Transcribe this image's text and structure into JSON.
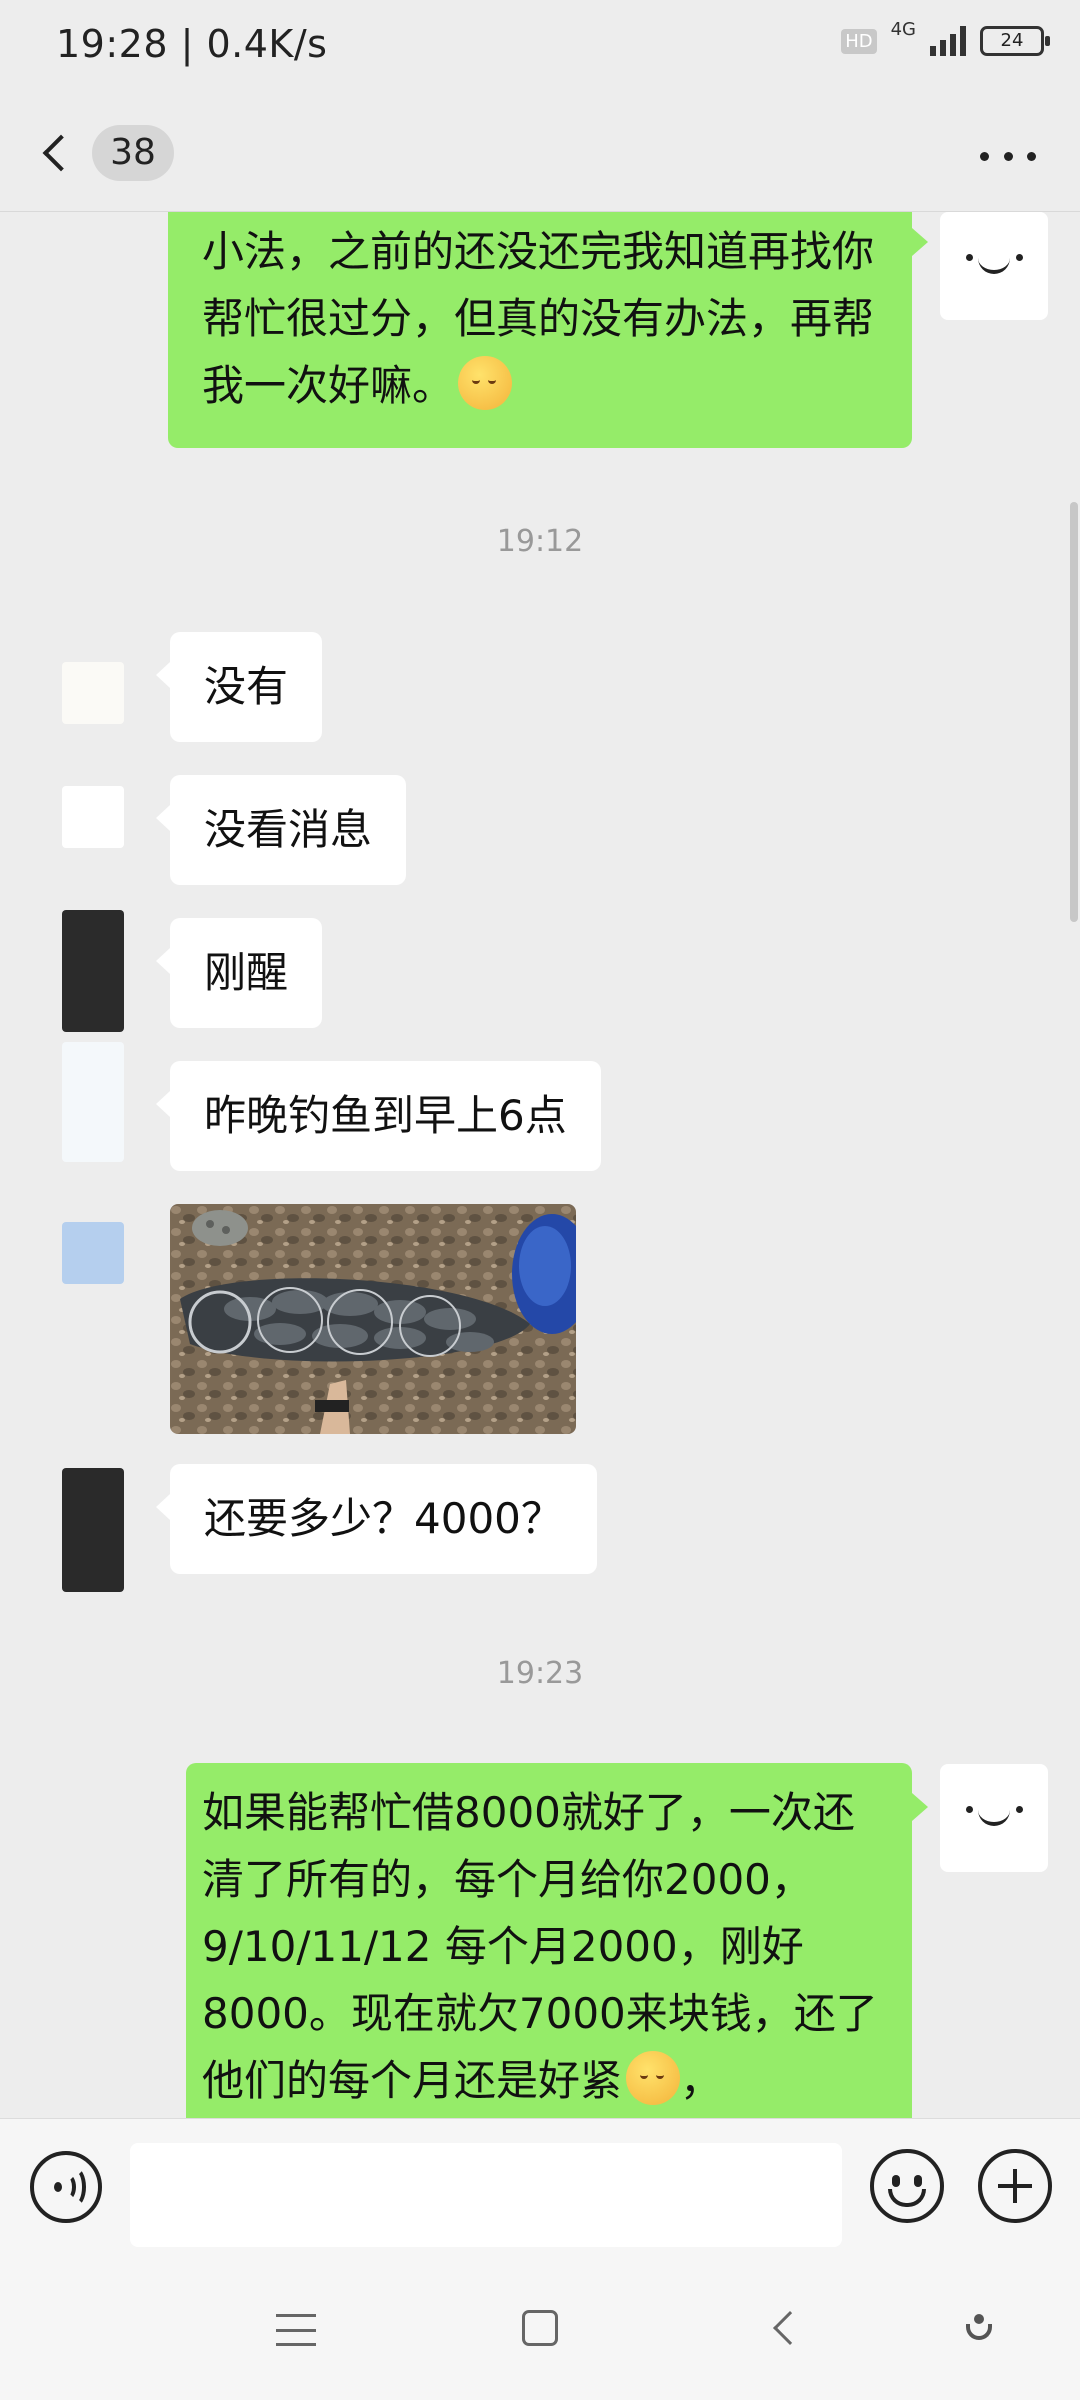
{
  "status_bar": {
    "time_speed": "19:28 | 0.4K/s",
    "hd": "HD",
    "network": "4G",
    "battery": "24"
  },
  "header": {
    "unread_count": "38"
  },
  "messages": [
    {
      "side": "me",
      "text": "小法，之前的还没还完我知道再找你帮忙很过分，但真的没有办法，再帮我一次好嘛。",
      "emoji": "pensive-face"
    },
    {
      "type": "time",
      "text": "19:12"
    },
    {
      "side": "them",
      "text": "没有"
    },
    {
      "side": "them",
      "text": "没看消息"
    },
    {
      "side": "them",
      "text": "刚醒"
    },
    {
      "side": "them",
      "text": "昨晚钓鱼到早上6点"
    },
    {
      "side": "them",
      "type": "image",
      "name": "fish-photo"
    },
    {
      "side": "them",
      "text": "还要多少？4000？"
    },
    {
      "type": "time",
      "text": "19:23"
    },
    {
      "side": "me",
      "text": "如果能帮忙借8000就好了，一次还清了所有的，每个月给你2000，9/10/11/12 每个月2000，刚好8000。现在就欠7000来块钱，还了他们的每个月还是好紧",
      "emoji": "pensive-face",
      "tail": "，"
    }
  ],
  "input": {
    "placeholder": ""
  },
  "colors": {
    "my_bubble": "#95ec69",
    "their_bubble": "#ffffff",
    "background": "#ededed"
  }
}
